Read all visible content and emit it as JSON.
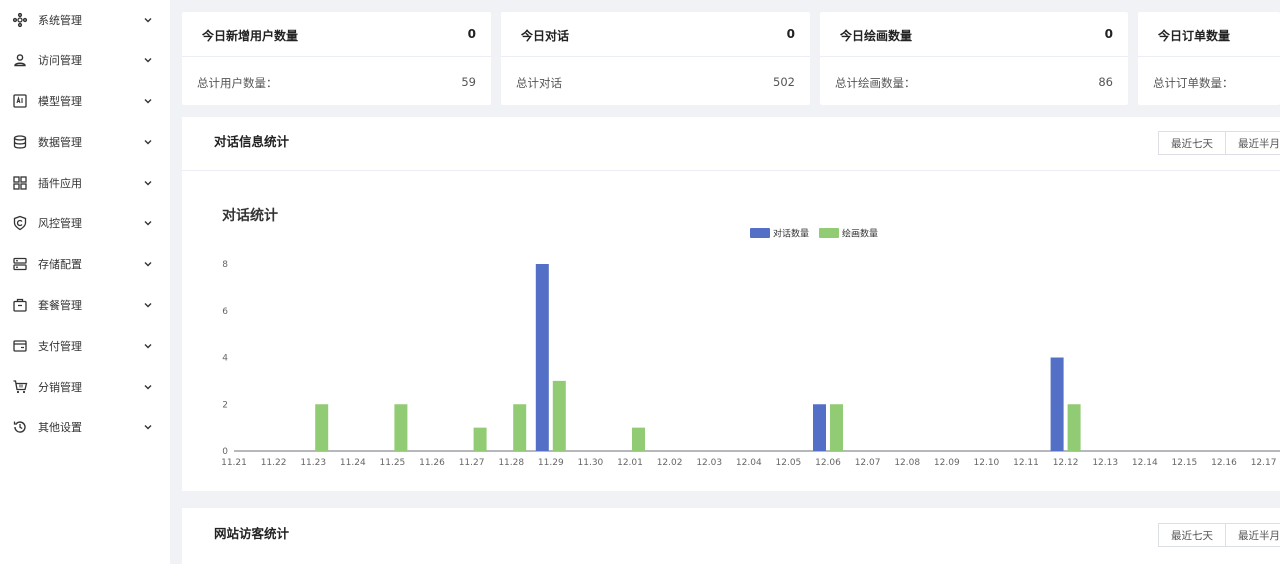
{
  "sidebar": {
    "items": [
      {
        "label": "系统管理",
        "icon": "settings-cross-icon"
      },
      {
        "label": "访问管理",
        "icon": "user-icon"
      },
      {
        "label": "模型管理",
        "icon": "ai-icon"
      },
      {
        "label": "数据管理",
        "icon": "database-icon"
      },
      {
        "label": "插件应用",
        "icon": "grid-icon"
      },
      {
        "label": "风控管理",
        "icon": "shield-icon"
      },
      {
        "label": "存储配置",
        "icon": "server-icon"
      },
      {
        "label": "套餐管理",
        "icon": "package-icon"
      },
      {
        "label": "支付管理",
        "icon": "wallet-icon"
      },
      {
        "label": "分销管理",
        "icon": "cart-icon"
      },
      {
        "label": "其他设置",
        "icon": "history-icon"
      }
    ]
  },
  "stats": [
    {
      "title": "今日新增用户数量",
      "value": "0",
      "total_label": "总计用户数量：",
      "total_value": "59"
    },
    {
      "title": "今日对话",
      "value": "0",
      "total_label": "总计对话",
      "total_value": "502"
    },
    {
      "title": "今日绘画数量",
      "value": "0",
      "total_label": "总计绘画数量：",
      "total_value": "86"
    },
    {
      "title": "今日订单数量",
      "value": "",
      "total_label": "总计订单数量：",
      "total_value": ""
    }
  ],
  "chat_panel": {
    "title": "对话信息统计",
    "btn_week": "最近七天",
    "btn_half": "最近半月"
  },
  "visit_panel": {
    "title": "网站访客统计",
    "btn_week": "最近七天",
    "btn_half": "最近半月"
  },
  "colors": {
    "series_chat": "#5470c6",
    "series_draw": "#91cc75"
  },
  "chart_data": {
    "type": "bar",
    "title": "对话统计",
    "categories": [
      "11.21",
      "11.22",
      "11.23",
      "11.24",
      "11.25",
      "11.26",
      "11.27",
      "11.28",
      "11.29",
      "11.30",
      "12.01",
      "12.02",
      "12.03",
      "12.04",
      "12.05",
      "12.06",
      "12.07",
      "12.08",
      "12.09",
      "12.10",
      "12.11",
      "12.12",
      "12.13",
      "12.14",
      "12.15",
      "12.16",
      "12.17"
    ],
    "series": [
      {
        "name": "对话数量",
        "values": [
          0,
          0,
          0,
          0,
          0,
          0,
          0,
          0,
          8,
          0,
          0,
          0,
          0,
          0,
          0,
          2,
          0,
          0,
          0,
          0,
          0,
          4,
          0,
          0,
          0,
          0,
          0
        ]
      },
      {
        "name": "绘画数量",
        "values": [
          0,
          0,
          2,
          0,
          2,
          0,
          1,
          2,
          3,
          0,
          1,
          0,
          0,
          0,
          0,
          2,
          0,
          0,
          0,
          0,
          0,
          2,
          0,
          0,
          0,
          0,
          0
        ]
      }
    ],
    "yticks": [
      0,
      2,
      4,
      6,
      8
    ],
    "ylim": [
      0,
      8
    ],
    "legend": "top-center",
    "grid": false
  }
}
